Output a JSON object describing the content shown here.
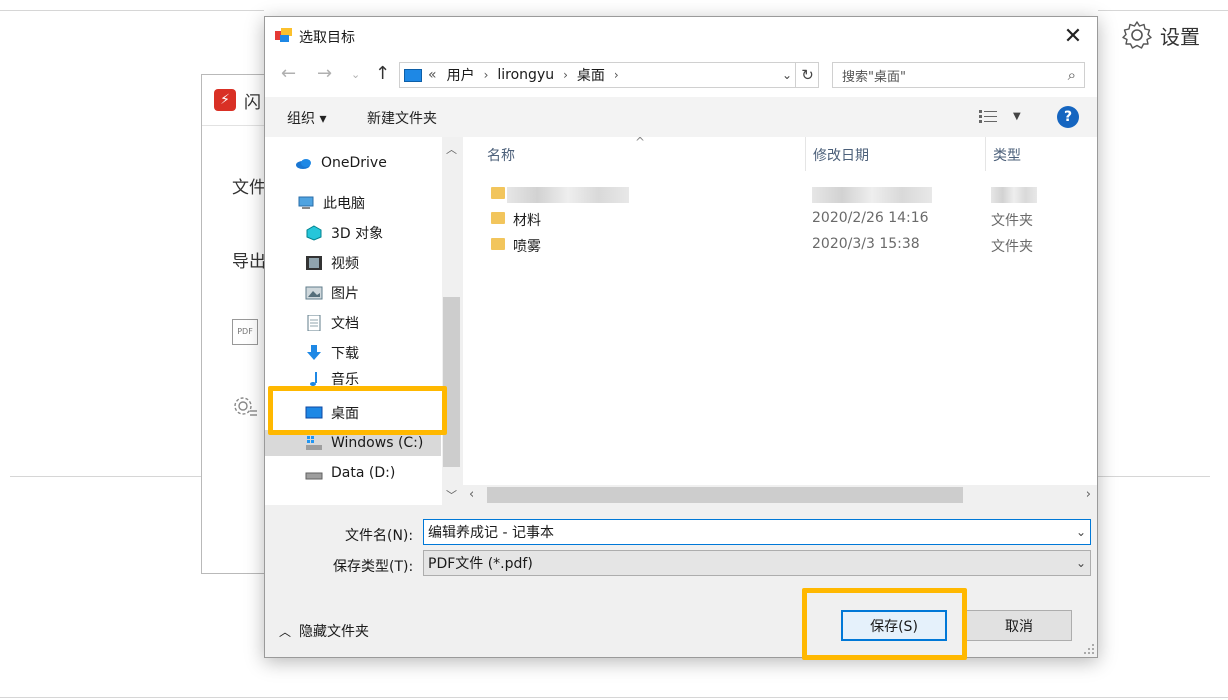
{
  "background": {
    "settings_label": "设置",
    "app_name": "闪",
    "labels": [
      "文件",
      "导出"
    ],
    "pdf_icon_text": "PDF"
  },
  "dialog": {
    "title": "选取目标",
    "address": {
      "prefix": "«",
      "crumbs": [
        "用户",
        "lirongyu",
        "桌面"
      ]
    },
    "search_placeholder": "搜索\"桌面\"",
    "toolbar": {
      "organize": "组织 ▾",
      "new_folder": "新建文件夹"
    },
    "nav_items": [
      {
        "label": "OneDrive",
        "icon": "onedrive-icon"
      },
      {
        "label": "此电脑",
        "icon": "computer-icon"
      },
      {
        "label": "3D 对象",
        "icon": "3d-objects-icon"
      },
      {
        "label": "视频",
        "icon": "video-icon"
      },
      {
        "label": "图片",
        "icon": "pictures-icon"
      },
      {
        "label": "文档",
        "icon": "documents-icon"
      },
      {
        "label": "下载",
        "icon": "download-icon"
      },
      {
        "label": "音乐",
        "icon": "music-icon"
      },
      {
        "label": "桌面",
        "icon": "desktop-icon"
      },
      {
        "label": "Windows (C:)",
        "icon": "drive-c-icon"
      },
      {
        "label": "Data (D:)",
        "icon": "drive-d-icon"
      }
    ],
    "columns": [
      "名称",
      "修改日期",
      "类型"
    ],
    "files": [
      {
        "name": "材料",
        "date": "2020/2/26 14:16",
        "type": "文件夹"
      },
      {
        "name": "喷雾",
        "date": "2020/3/3 15:38",
        "type": "文件夹"
      }
    ],
    "filename_label": "文件名(N):",
    "filename_value": "编辑养成记 - 记事本",
    "filetype_label": "保存类型(T):",
    "filetype_value": "PDF文件 (*.pdf)",
    "hide_folders": "隐藏文件夹",
    "save_button": "保存(S)",
    "cancel_button": "取消"
  },
  "colors": {
    "highlight": "#ffb800",
    "accent": "#0078d7",
    "folder": "#f2c55c"
  }
}
